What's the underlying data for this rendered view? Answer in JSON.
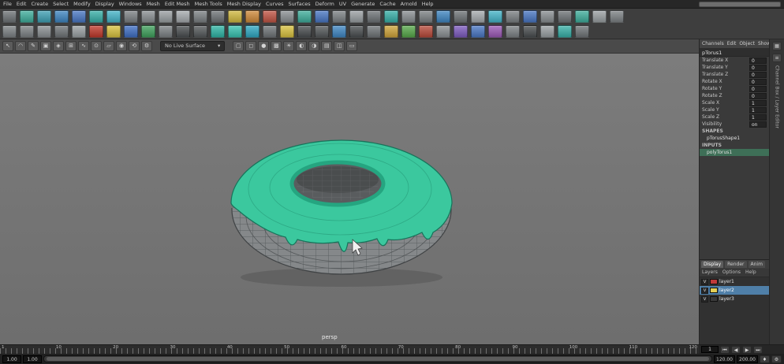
{
  "menubar": {
    "items": [
      "File",
      "Edit",
      "Create",
      "Select",
      "Modify",
      "Display",
      "Windows",
      "Mesh",
      "Edit Mesh",
      "Mesh Tools",
      "Mesh Display",
      "Curves",
      "Surfaces",
      "Deform",
      "UV",
      "Generate",
      "Cache",
      "Arnold",
      "Help"
    ],
    "field_value": ""
  },
  "shelf": {
    "row1": [
      {
        "name": "select-mask",
        "color": "#6f7477"
      },
      {
        "name": "poly-sphere",
        "color": "#3fae9c"
      },
      {
        "name": "poly-cube",
        "color": "#3fa0b4"
      },
      {
        "name": "poly-cylinder",
        "color": "#3f86c2"
      },
      {
        "name": "poly-cone",
        "color": "#4a77c4"
      },
      {
        "name": "poly-torus",
        "color": "#38b0a8"
      },
      {
        "name": "poly-plane",
        "color": "#45b5c9"
      },
      {
        "name": "poly-disc",
        "color": "#7c8184"
      },
      {
        "name": "platonic-solid",
        "color": "#8a8f92"
      },
      {
        "name": "boolean",
        "color": "#9aa0a3"
      },
      {
        "name": "combine",
        "color": "#a6abae"
      },
      {
        "name": "separate",
        "color": "#7c8184"
      },
      {
        "name": "extract",
        "color": "#6f7477"
      },
      {
        "name": "bevel",
        "color": "#d1b93f"
      },
      {
        "name": "bridge",
        "color": "#cf8a3a"
      },
      {
        "name": "extrude",
        "color": "#c25545"
      },
      {
        "name": "smooth",
        "color": "#8a8f92"
      },
      {
        "name": "multi-cut",
        "color": "#3fae9c"
      },
      {
        "name": "target-weld",
        "color": "#4a77c4"
      },
      {
        "name": "quad-draw",
        "color": "#7c8184"
      },
      {
        "name": "mirror",
        "color": "#9aa0a3"
      },
      {
        "name": "crease",
        "color": "#6f7477"
      },
      {
        "name": "sculpt",
        "color": "#38b0a8"
      },
      {
        "name": "relax",
        "color": "#8a8f92"
      },
      {
        "name": "grab",
        "color": "#7c8184"
      },
      {
        "name": "pinch",
        "color": "#3f86c2"
      },
      {
        "name": "knife",
        "color": "#6f7477"
      },
      {
        "name": "smooth-brush",
        "color": "#a6abae"
      },
      {
        "name": "spin-edge",
        "color": "#45b5c9"
      },
      {
        "name": "symmetry",
        "color": "#7c8184"
      },
      {
        "name": "wedge",
        "color": "#4a77c4"
      },
      {
        "name": "poke",
        "color": "#8a8f92"
      },
      {
        "name": "chamfer",
        "color": "#6f7477"
      },
      {
        "name": "triangulate",
        "color": "#3fae9c"
      },
      {
        "name": "quadrangulate",
        "color": "#9aa0a3"
      },
      {
        "name": "reduce",
        "color": "#7c8184"
      }
    ],
    "row2": [
      {
        "name": "undo",
        "color": "#7c8184"
      },
      {
        "name": "redo",
        "color": "#7c8184"
      },
      {
        "name": "render",
        "color": "#8a8f92"
      },
      {
        "name": "ipr-render",
        "color": "#6f7477"
      },
      {
        "name": "render-settings",
        "color": "#9aa0a3"
      },
      {
        "name": "standard-surface",
        "color": "#c0392b"
      },
      {
        "name": "blinn",
        "color": "#d9c23f"
      },
      {
        "name": "lambert",
        "color": "#3f6fc4"
      },
      {
        "name": "phong",
        "color": "#3fa05c"
      },
      {
        "name": "ai-standard",
        "color": "#7c8184"
      },
      {
        "name": "displacement",
        "color": "#4a4e50"
      },
      {
        "name": "bump",
        "color": "#55595b"
      },
      {
        "name": "texture",
        "color": "#2fb5a5"
      },
      {
        "name": "ramp",
        "color": "#38c2b0"
      },
      {
        "name": "noise",
        "color": "#2fa8c2"
      },
      {
        "name": "checker",
        "color": "#6f7477"
      },
      {
        "name": "directional-light",
        "color": "#d9c23f"
      },
      {
        "name": "spot-light",
        "color": "#4a4e50"
      },
      {
        "name": "area-light",
        "color": "#55595b"
      },
      {
        "name": "skydome-light",
        "color": "#3f86c2"
      },
      {
        "name": "mesh-light",
        "color": "#4a4e50"
      },
      {
        "name": "photometric-light",
        "color": "#6f7477"
      },
      {
        "name": "physical-sky",
        "color": "#cfa43a"
      },
      {
        "name": "shadow-matte",
        "color": "#57a84a"
      },
      {
        "name": "ambient-occlusion",
        "color": "#b84a3a"
      },
      {
        "name": "curvature",
        "color": "#8a8f92"
      },
      {
        "name": "utility",
        "color": "#7d5bbf"
      },
      {
        "name": "mix-shader",
        "color": "#4a77c4"
      },
      {
        "name": "switch",
        "color": "#9b59b6"
      },
      {
        "name": "range",
        "color": "#7c8184"
      },
      {
        "name": "stop",
        "color": "#4a4e50"
      },
      {
        "name": "object-id",
        "color": "#9aa0a3"
      },
      {
        "name": "motion-vector",
        "color": "#38b0a8"
      },
      {
        "name": "depth",
        "color": "#6f7477"
      }
    ]
  },
  "panel_toolbar": {
    "left_icons": [
      {
        "name": "select-tool",
        "glyph": "↖"
      },
      {
        "name": "lasso-tool",
        "glyph": "◠"
      },
      {
        "name": "paint-select-tool",
        "glyph": "✎"
      },
      {
        "name": "select-object-mode",
        "glyph": "▣"
      },
      {
        "name": "select-component-mode",
        "glyph": "◈"
      },
      {
        "name": "snap-to-grid",
        "glyph": "⊞"
      },
      {
        "name": "snap-to-curve",
        "glyph": "∿"
      },
      {
        "name": "snap-to-point",
        "glyph": "⊙"
      },
      {
        "name": "snap-to-plane",
        "glyph": "▱"
      },
      {
        "name": "make-live",
        "glyph": "◉"
      },
      {
        "name": "construction-history",
        "glyph": "⟲"
      },
      {
        "name": "tool-settings",
        "glyph": "⚙"
      }
    ],
    "dropdown_label": "No Live Surface",
    "caret_glyph": "▾",
    "right_icons": [
      {
        "name": "isolate-select",
        "glyph": "▢"
      },
      {
        "name": "wireframe-display",
        "glyph": "◻"
      },
      {
        "name": "shaded-display",
        "glyph": "●"
      },
      {
        "name": "textured-display",
        "glyph": "▩"
      },
      {
        "name": "lighting-toggle",
        "glyph": "☀"
      },
      {
        "name": "shadows-toggle",
        "glyph": "◐"
      },
      {
        "name": "ambient-occlusion-toggle",
        "glyph": "◑"
      },
      {
        "name": "cap-display",
        "glyph": "▤"
      },
      {
        "name": "xray-toggle",
        "glyph": "◫"
      },
      {
        "name": "camera-attributes",
        "glyph": "▭"
      }
    ]
  },
  "viewport": {
    "camera_label": "persp",
    "selection_color": "#3bc89e",
    "rim_color": "#25a580"
  },
  "channel_box": {
    "tabs": [
      "Channels",
      "Edit",
      "Object",
      "Show"
    ],
    "object_name": "pTorus1",
    "rows": [
      {
        "label": "Translate X",
        "value": "0"
      },
      {
        "label": "Translate Y",
        "value": "0"
      },
      {
        "label": "Translate Z",
        "value": "0"
      },
      {
        "label": "Rotate X",
        "value": "0"
      },
      {
        "label": "Rotate Y",
        "value": "0"
      },
      {
        "label": "Rotate Z",
        "value": "0"
      },
      {
        "label": "Scale X",
        "value": "1"
      },
      {
        "label": "Scale Y",
        "value": "1"
      },
      {
        "label": "Scale Z",
        "value": "1"
      },
      {
        "label": "Visibility",
        "value": "on"
      }
    ],
    "sections": [
      {
        "title": "SHAPES",
        "items": [
          {
            "label": "pTorusShape1",
            "highlight": false
          }
        ]
      },
      {
        "title": "INPUTS",
        "items": [
          {
            "label": "polyTorus1",
            "highlight": true
          }
        ]
      }
    ]
  },
  "layer_editor": {
    "tabs": [
      {
        "label": "Display",
        "active": true
      },
      {
        "label": "Render",
        "active": false
      },
      {
        "label": "Anim",
        "active": false
      }
    ],
    "menu": [
      "Layers",
      "Options",
      "Help"
    ],
    "layers": [
      {
        "vis": "V",
        "color": "#c03a3a",
        "name": "layer1",
        "selected": false
      },
      {
        "vis": "V",
        "color": "#e3cf55",
        "name": "layer2",
        "selected": true
      },
      {
        "vis": "V",
        "color": "",
        "name": "layer3",
        "selected": false
      }
    ]
  },
  "right_strip": {
    "icons": [
      {
        "name": "workspace-icon",
        "glyph": "▦"
      },
      {
        "name": "panel-options-icon",
        "glyph": "≡"
      }
    ],
    "labels": [
      "Channel Box / Layer Editor"
    ]
  },
  "timeline": {
    "tick_labels": [
      "1",
      "10",
      "20",
      "30",
      "40",
      "50",
      "60",
      "70",
      "80",
      "90",
      "100",
      "110",
      "120"
    ],
    "current_frame": "1",
    "playback": [
      {
        "name": "go-to-start",
        "glyph": "⏮"
      },
      {
        "name": "step-back",
        "glyph": "◀"
      },
      {
        "name": "play-forward",
        "glyph": "▶"
      },
      {
        "name": "go-to-end",
        "glyph": "⏭"
      }
    ]
  },
  "range_bar": {
    "left_fields": [
      {
        "name": "animation-start-field",
        "value": "1.00"
      },
      {
        "name": "playback-start-field",
        "value": "1.00"
      }
    ],
    "right_fields": [
      {
        "name": "playback-end-field",
        "value": "120.00"
      },
      {
        "name": "animation-end-field",
        "value": "200.00"
      }
    ],
    "buttons": [
      {
        "name": "auto-keyframe-toggle",
        "glyph": "♦"
      },
      {
        "name": "animation-preferences",
        "glyph": "⚙"
      }
    ]
  }
}
